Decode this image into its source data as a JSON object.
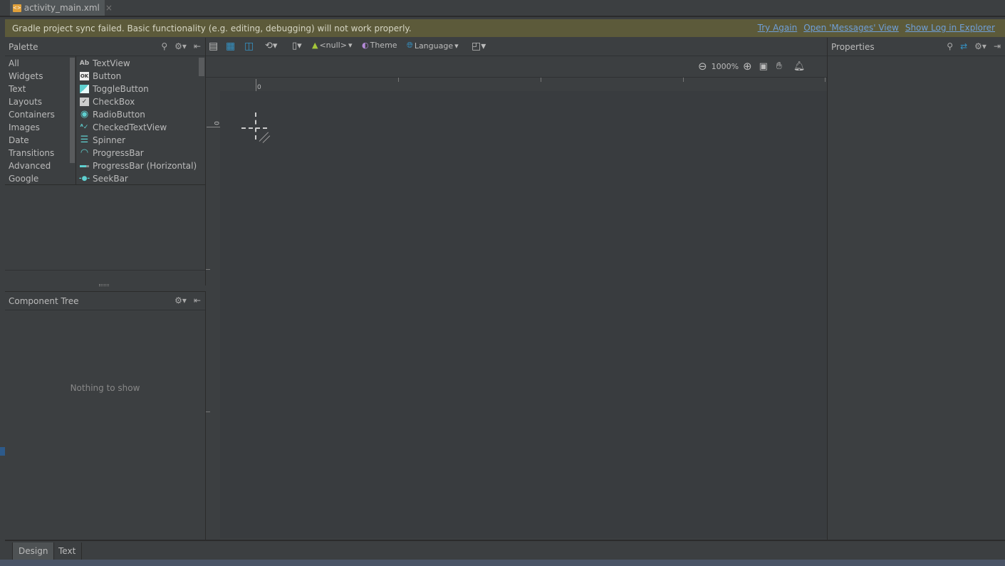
{
  "file_tab": {
    "name": "activity_main.xml",
    "close": "×"
  },
  "banner": {
    "message": "Gradle project sync failed. Basic functionality (e.g. editing, debugging) will not work properly.",
    "links": [
      "Try Again",
      "Open 'Messages' View",
      "Show Log in Explorer"
    ]
  },
  "palette": {
    "title": "Palette",
    "categories": [
      "All",
      "Widgets",
      "Text",
      "Layouts",
      "Containers",
      "Images",
      "Date",
      "Transitions",
      "Advanced",
      "Google"
    ],
    "items": [
      {
        "label": "TextView",
        "icon": "Ab"
      },
      {
        "label": "Button",
        "icon": "OK"
      },
      {
        "label": "ToggleButton",
        "icon": "toggle-icon"
      },
      {
        "label": "CheckBox",
        "icon": "checkbox-icon"
      },
      {
        "label": "RadioButton",
        "icon": "radio-icon"
      },
      {
        "label": "CheckedTextView",
        "icon": "checked-text-icon"
      },
      {
        "label": "Spinner",
        "icon": "spinner-icon"
      },
      {
        "label": "ProgressBar",
        "icon": "progress-icon"
      },
      {
        "label": "ProgressBar (Horizontal)",
        "icon": "progress-horizontal-icon"
      },
      {
        "label": "SeekBar",
        "icon": "seekbar-icon"
      }
    ]
  },
  "toolbar": {
    "device_api": "<null>",
    "theme": "Theme",
    "language": "Language",
    "zoom": "1000%"
  },
  "ruler": {
    "h_origin": "0",
    "v_origin": "0"
  },
  "component_tree": {
    "title": "Component Tree",
    "empty": "Nothing to show"
  },
  "properties": {
    "title": "Properties"
  },
  "bottom_tabs": [
    "Design",
    "Text"
  ],
  "colors": {
    "banner": "#5c5a3a",
    "link": "#6f9fd8",
    "accent": "#3592c4",
    "icon_teal": "#5fd0d0"
  }
}
